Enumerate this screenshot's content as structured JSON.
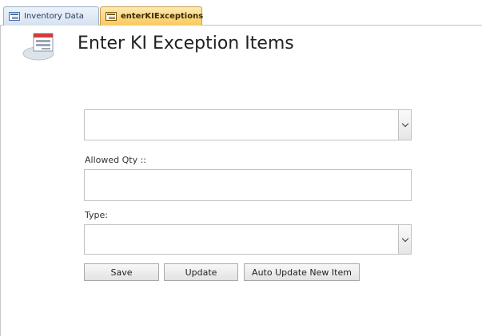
{
  "tabs": [
    {
      "label": "Inventory Data",
      "active": false
    },
    {
      "label": "enterKIExceptions",
      "active": true
    }
  ],
  "form": {
    "title": "Enter KI Exception Items",
    "item_combo": {
      "value": ""
    },
    "allowed_qty": {
      "label": "Allowed Qty ::",
      "value": ""
    },
    "type": {
      "label": "Type:",
      "value": ""
    }
  },
  "buttons": {
    "save": "Save",
    "update": "Update",
    "auto_update": "Auto Update New Item"
  },
  "colors": {
    "active_tab": "#f9c95c",
    "inactive_tab": "#d6e1f0"
  },
  "icons": {
    "form_icon": "form-icon",
    "tab_icon": "form-tab-icon",
    "dropdown": "chevron-down-icon"
  }
}
